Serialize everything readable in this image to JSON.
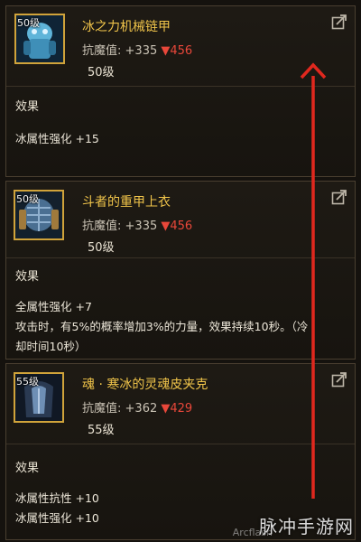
{
  "items": [
    {
      "level_tag": "50级",
      "name": "冰之力机械链甲",
      "stat_label": "抗魔值:",
      "stat_value": "+335",
      "stat_delta": "▼456",
      "level": "50级",
      "effects_heading": "效果",
      "effects": [
        "冰属性强化 +15"
      ]
    },
    {
      "level_tag": "50级",
      "name": "斗者的重甲上衣",
      "stat_label": "抗魔值:",
      "stat_value": "+335",
      "stat_delta": "▼456",
      "level": "50级",
      "effects_heading": "效果",
      "effects": [
        "全属性强化 +7",
        "攻击时，有5%的概率增加3%的力量，效果持续10秒。（冷",
        "却时间10秒）"
      ]
    },
    {
      "level_tag": "55级",
      "name": "魂 · 寒冰的灵魂皮夹克",
      "stat_label": "抗魔值:",
      "stat_value": "+362",
      "stat_delta": "▼429",
      "level": "55级",
      "effects_heading": "效果",
      "effects": [
        "冰属性抗性 +10",
        "冰属性强化 +10"
      ]
    }
  ],
  "watermark": {
    "text": "脉冲手游网",
    "sub": "Arcflash"
  },
  "colors": {
    "title_gold": "#f0c44a",
    "delta_red": "#e8473a",
    "arrow_red": "#e0281e",
    "frame_gold": "#d0a33a"
  },
  "icons": [
    "share-icon",
    "armor-icon",
    "up-arrow-annotation"
  ]
}
